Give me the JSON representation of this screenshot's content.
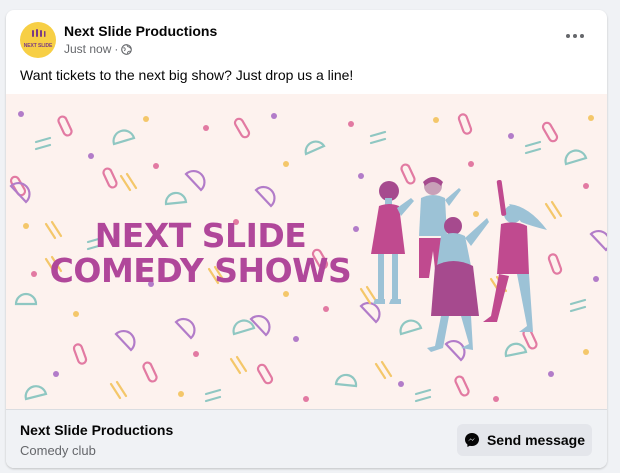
{
  "post": {
    "page_name": "Next Slide Productions",
    "timestamp": "Just now",
    "separator": "·",
    "text": "Want tickets to the next big show? Just drop us a line!",
    "avatar_text": "NEXT SLIDE"
  },
  "image": {
    "headline_line1": "NEXT SLIDE",
    "headline_line2": "COMEDY SHOWS"
  },
  "footer": {
    "title": "Next Slide Productions",
    "subtitle": "Comedy club",
    "button_label": "Send message"
  },
  "icons": {
    "globe": "globe-icon",
    "more": "more-options-icon",
    "messenger": "messenger-icon"
  },
  "colors": {
    "headline": "#b0479a",
    "image_bg": "#fdf2ee",
    "avatar_bg": "#f7cf45",
    "button_bg": "#e4e6eb"
  }
}
